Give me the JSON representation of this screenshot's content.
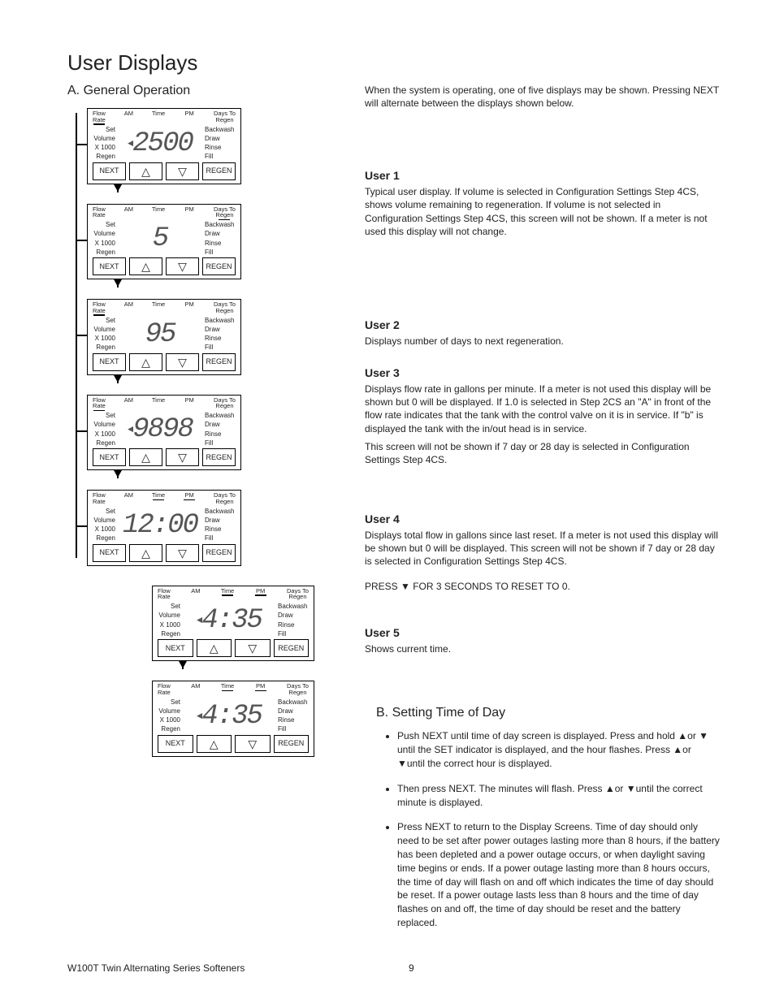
{
  "page": {
    "title": "User Displays",
    "section_a": "A.  General Operation",
    "section_b": "B.  Setting Time of Day",
    "footer_product": "W100T Twin Alternating Series Softeners",
    "page_number": "9"
  },
  "panel_common": {
    "top": {
      "flow_rate": "Flow\nRate",
      "am": "AM",
      "time": "Time",
      "pm": "PM",
      "days_to_regen": "Days To\nRegen"
    },
    "left": [
      "Set",
      "Volume",
      "X 1000",
      "Regen"
    ],
    "right": [
      "Backwash",
      "Draw",
      "Rinse",
      "Fill"
    ],
    "buttons": {
      "next": "NEXT",
      "regen": "REGEN"
    }
  },
  "panels": [
    {
      "id": "p1",
      "value": "2500",
      "left_arrow": true
    },
    {
      "id": "p2",
      "value": "5",
      "left_arrow": false
    },
    {
      "id": "p3",
      "value": "95",
      "left_arrow": false
    },
    {
      "id": "p4",
      "value": "9898",
      "left_arrow": true
    },
    {
      "id": "p5",
      "value": "12:00",
      "left_arrow": false
    },
    {
      "id": "p6",
      "value": "4:35",
      "left_arrow": true
    },
    {
      "id": "p7",
      "value": "4:35",
      "left_arrow": true
    }
  ],
  "right": {
    "intro": "When the system is operating, one of five displays may be shown. Pressing NEXT will alternate between the displays shown below.",
    "user1": {
      "h": "User 1",
      "p": "Typical user display. If volume is selected in Configuration Settings Step 4CS, shows volume remaining to regeneration. If volume is not selected in Configuration Settings Step 4CS, this screen will not be shown. If a meter is not used this display will not change."
    },
    "user2": {
      "h": "User 2",
      "p": "Displays number of days to next regeneration."
    },
    "user3": {
      "h": "User 3",
      "p1": "Displays flow rate in gallons per minute. If a meter is not used this display will be shown but 0 will be displayed. If 1.0   is selected in Step 2CS an \"A\" in front of the flow rate indicates that the tank with the control valve on it is in service. If \"b\" is displayed the tank with the in/out head is in service.",
      "p2": "This screen will not be shown if 7 day or 28 day is selected in Configuration Settings Step 4CS."
    },
    "user4": {
      "h": "User 4",
      "p1": "Displays total flow in gallons since last reset. If a meter is not used this display will be shown but 0 will be displayed. This screen will not be shown if 7 day or 28 day is selected in Configuration Settings Step 4CS.",
      "p2": "PRESS ▼ FOR 3 SECONDS TO RESET TO 0."
    },
    "user5": {
      "h": "User 5",
      "p": "Shows current time."
    },
    "b_items": [
      "Push NEXT until time of day screen is displayed. Press and hold ▲or ▼ until the SET indicator is displayed, and the hour flashes. Press ▲or ▼until the correct hour is displayed.",
      "Then press NEXT. The minutes will flash. Press ▲or ▼until the correct minute is displayed.",
      "Press NEXT to return to the Display Screens. Time of day should only need to be set after power outages lasting more than 8 hours, if the battery has been depleted and a power outage occurs, or when daylight saving time begins or ends. If a power outage lasting more than 8 hours occurs, the time of day will flash on and off which indicates the time of day should be reset. If a power outage lasts less than 8 hours and the time of day flashes on and off, the time of day should be reset and the battery replaced."
    ]
  }
}
